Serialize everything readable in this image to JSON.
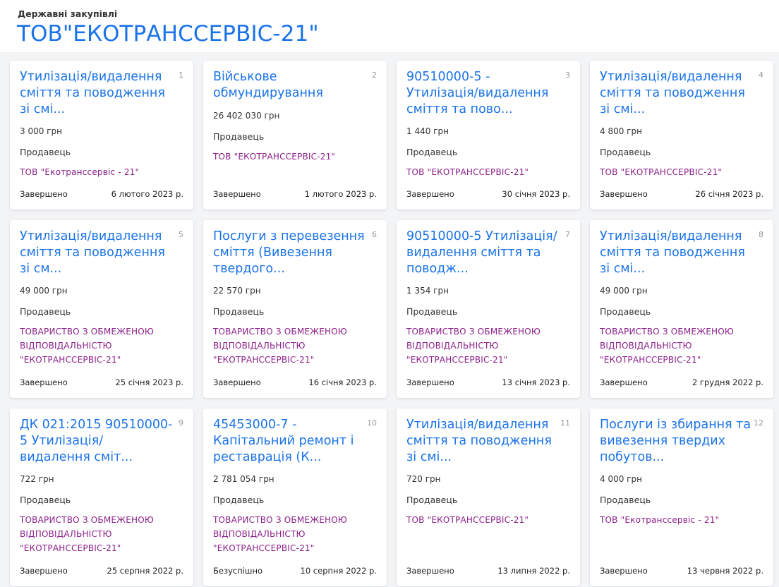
{
  "header": {
    "subtitle": "Державні закупівлі",
    "title": "ТОВ\"ЕКОТРАНССЕРВІС-21\""
  },
  "seller_label": "Продавець",
  "cards": [
    {
      "num": "1",
      "title": "Утилізація/видалення сміття та поводження зі смі...",
      "price": "3 000 грн",
      "seller": "ТОВ \"Екотранссервіс - 21\"",
      "status": "Завершено",
      "date": "6 лютого 2023 р."
    },
    {
      "num": "2",
      "title": "Військове обмундирування",
      "price": "26 402 030 грн",
      "seller": "ТОВ \"ЕКОТРАНССЕРВІС-21\"",
      "status": "Завершено",
      "date": "1 лютого 2023 р."
    },
    {
      "num": "3",
      "title": "90510000-5 - Утилізація/видалення сміття та пово...",
      "price": "1 440 грн",
      "seller": "ТОВ \"ЕКОТРАНССЕРВІС-21\"",
      "status": "Завершено",
      "date": "30 січня 2023 р."
    },
    {
      "num": "4",
      "title": "Утилізація/видалення сміття та поводження зі смі...",
      "price": "4 800 грн",
      "seller": "ТОВ \"ЕКОТРАНССЕРВІС-21\"",
      "status": "Завершено",
      "date": "26 січня 2023 р."
    },
    {
      "num": "5",
      "title": "Утилізація/видалення сміття та поводження зі см...",
      "price": "49 000 грн",
      "seller": "ТОВАРИСТВО З ОБМЕЖЕНОЮ ВІДПОВІДАЛЬНІСТЮ \"ЕКОТРАНССЕРВІС-21\"",
      "status": "Завершено",
      "date": "25 січня 2023 р."
    },
    {
      "num": "6",
      "title": "Послуги з перевезення сміття (Вивезення твердого...",
      "price": "22 570 грн",
      "seller": "ТОВАРИСТВО З ОБМЕЖЕНОЮ ВІДПОВІДАЛЬНІСТЮ \"ЕКОТРАНССЕРВІС-21\"",
      "status": "Завершено",
      "date": "16 січня 2023 р."
    },
    {
      "num": "7",
      "title": "90510000-5 Утилізація/видалення сміття та поводж...",
      "price": "1 354 грн",
      "seller": "ТОВАРИСТВО З ОБМЕЖЕНОЮ ВІДПОВІДАЛЬНІСТЮ \"ЕКОТРАНССЕРВІС-21\"",
      "status": "Завершено",
      "date": "13 січня 2023 р."
    },
    {
      "num": "8",
      "title": "Утилізація/видалення сміття та поводження зі смі...",
      "price": "49 000 грн",
      "seller": "ТОВАРИСТВО З ОБМЕЖЕНОЮ ВІДПОВІДАЛЬНІСТЮ \"ЕКОТРАНССЕРВІС-21\"",
      "status": "Завершено",
      "date": "2 грудня 2022 р."
    },
    {
      "num": "9",
      "title": "ДК 021:2015 90510000-5 Утилізація/видалення сміт...",
      "price": "722 грн",
      "seller": "ТОВАРИСТВО З ОБМЕЖЕНОЮ ВІДПОВІДАЛЬНІСТЮ \"ЕКОТРАНССЕРВІС-21\"",
      "status": "Завершено",
      "date": "25 серпня 2022 р."
    },
    {
      "num": "10",
      "title": "45453000-7 - Капітальний ремонт і реставрація (К...",
      "price": "2 781 054 грн",
      "seller": "ТОВАРИСТВО З ОБМЕЖЕНОЮ ВІДПОВІДАЛЬНІСТЮ \"ЕКОТРАНССЕРВІС-21\"",
      "status": "Безуспішно",
      "date": "10 серпня 2022 р."
    },
    {
      "num": "11",
      "title": "Утилізація/видалення сміття та поводження зі смі...",
      "price": "720 грн",
      "seller": "ТОВ \"ЕКОТРАНССЕРВІС-21\"",
      "status": "Завершено",
      "date": "13 липня 2022 р."
    },
    {
      "num": "12",
      "title": "Послуги із збирання та вивезення твердих побутов...",
      "price": "4 000 грн",
      "seller": "ТОВ \"Екотранссервіс - 21\"",
      "status": "Завершено",
      "date": "13 червня 2022 р."
    }
  ]
}
